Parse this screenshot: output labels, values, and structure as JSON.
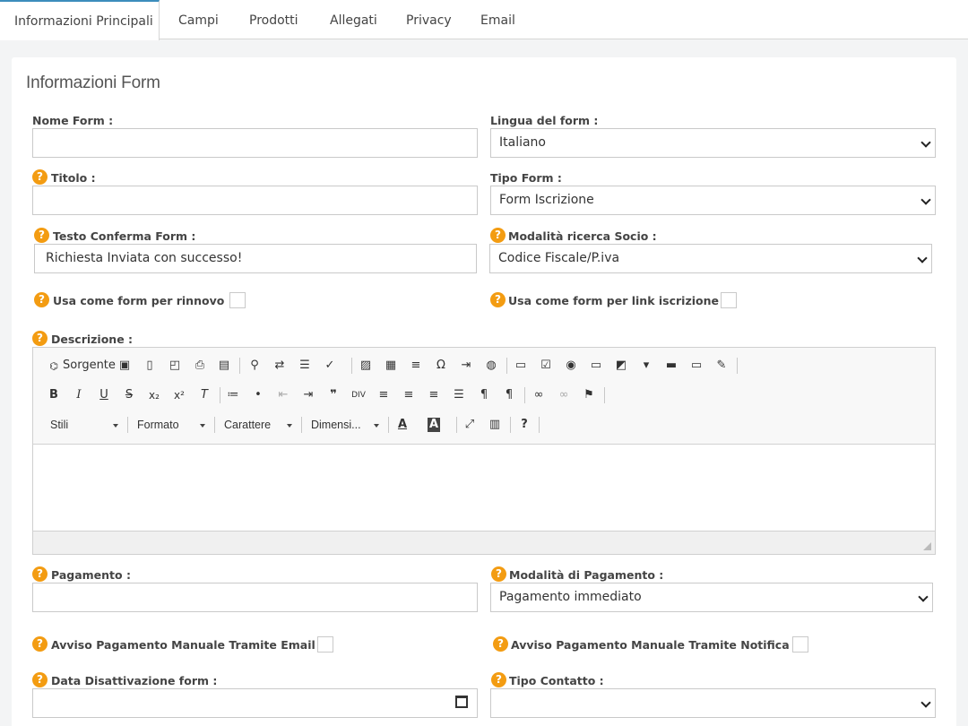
{
  "tabs": [
    "Informazioni Principali",
    "Campi",
    "Prodotti",
    "Allegati",
    "Privacy",
    "Email"
  ],
  "card": {
    "title": "Informazioni Form"
  },
  "fields": {
    "nome_form": {
      "label": "Nome Form :",
      "value": ""
    },
    "lingua": {
      "label": "Lingua del form :",
      "value": "Italiano"
    },
    "titolo": {
      "label": "Titolo :",
      "value": ""
    },
    "tipo_form": {
      "label": "Tipo Form :",
      "value": "Form Iscrizione"
    },
    "testo_conferma": {
      "label": "Testo Conferma Form :",
      "value": "Richiesta Inviata con successo!"
    },
    "modalita_ricerca": {
      "label": "Modalità ricerca Socio :",
      "value": "Codice Fiscale/P.iva"
    },
    "usa_rinnovo": {
      "label": "Usa come form per rinnovo :",
      "checked": false
    },
    "usa_link": {
      "label": "Usa come form per link iscrizione :",
      "checked": false
    },
    "descrizione": {
      "label": "Descrizione :"
    },
    "pagamento": {
      "label": "Pagamento :",
      "value": ""
    },
    "modalita_pagamento": {
      "label": "Modalità di Pagamento :",
      "value": "Pagamento immediato"
    },
    "avviso_email": {
      "label": "Avviso Pagamento Manuale Tramite Email :",
      "checked": false
    },
    "avviso_notifica": {
      "label": "Avviso Pagamento Manuale Tramite Notifica :",
      "checked": false
    },
    "data_disattivazione": {
      "label": "Data Disattivazione form :",
      "value": ""
    },
    "tipo_contatto": {
      "label": "Tipo Contatto :",
      "value": ""
    }
  },
  "editor": {
    "source_label": "Sorgente",
    "combos": [
      "Stili",
      "Formato",
      "Carattere",
      "Dimensi..."
    ],
    "help_glyph": "?"
  }
}
